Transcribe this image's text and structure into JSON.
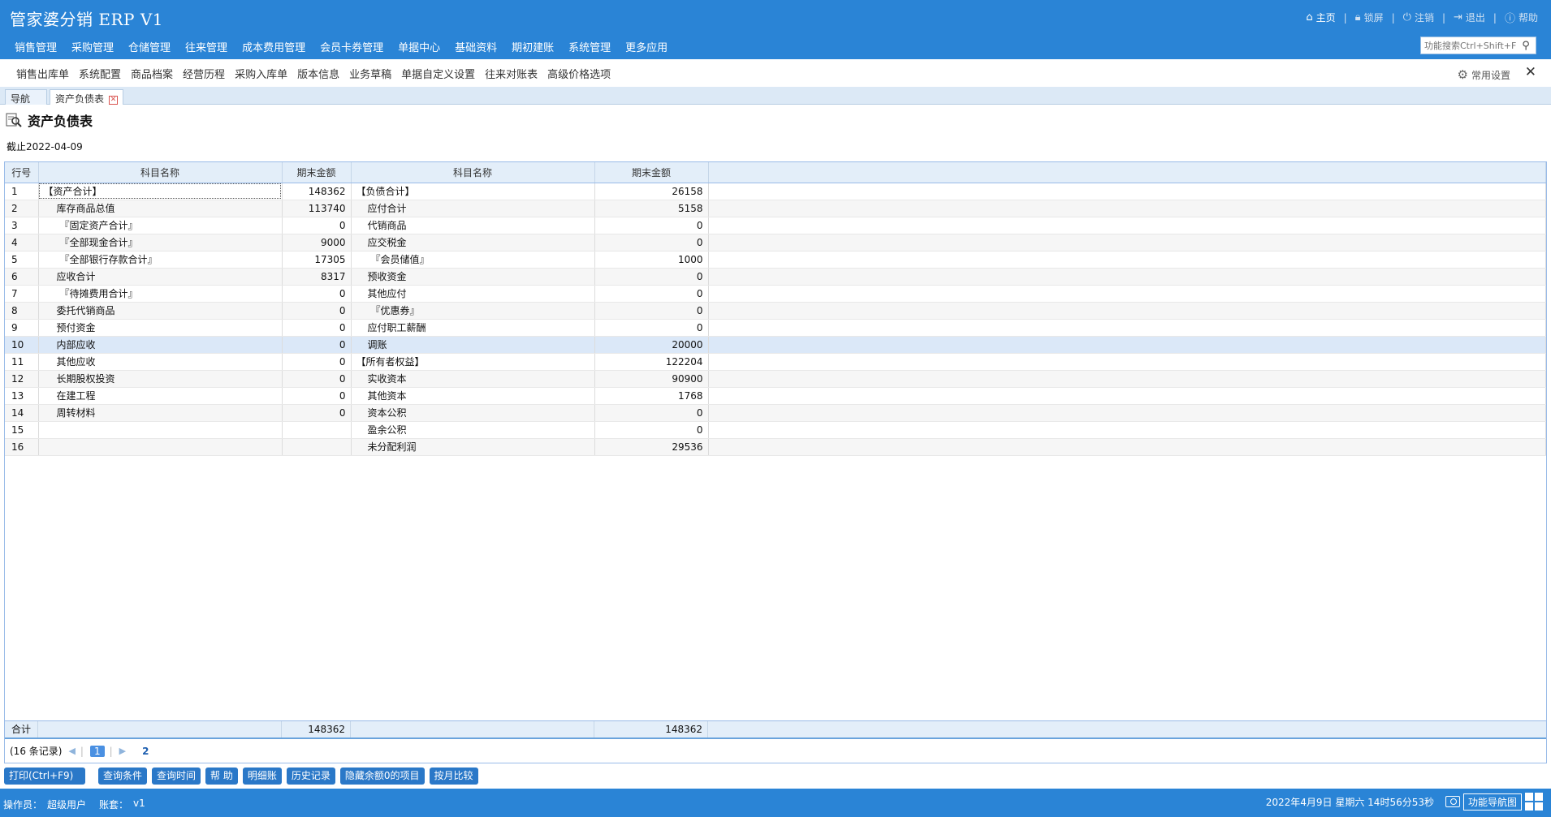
{
  "app": {
    "title": "管家婆分销 ERP V1"
  },
  "top_actions": [
    {
      "label": "主页",
      "icon": "home-icon"
    },
    {
      "label": "锁屏",
      "icon": "lock-icon"
    },
    {
      "label": "注销",
      "icon": "logout-icon"
    },
    {
      "label": "退出",
      "icon": "exit-icon"
    },
    {
      "label": "帮助",
      "icon": "info-icon"
    }
  ],
  "main_nav": [
    "销售管理",
    "采购管理",
    "仓储管理",
    "往来管理",
    "成本费用管理",
    "会员卡券管理",
    "单据中心",
    "基础资料",
    "期初建账",
    "系统管理",
    "更多应用"
  ],
  "search": {
    "placeholder": "功能搜索Ctrl+Shift+F"
  },
  "quick_links": [
    "销售出库单",
    "系统配置",
    "商品档案",
    "经营历程",
    "采购入库单",
    "版本信息",
    "业务草稿",
    "单据自定义设置",
    "往来对账表",
    "高级价格选项"
  ],
  "settings_label": "常用设置",
  "tabs": [
    {
      "label": "导航"
    },
    {
      "label": "资产负债表"
    }
  ],
  "page": {
    "title": "资产负债表",
    "as_of": "截止2022-04-09"
  },
  "table": {
    "headers": [
      "行号",
      "科目名称",
      "期末金额",
      "科目名称",
      "期末金额"
    ],
    "rows": [
      {
        "no": "1",
        "asset": "【资产合计】",
        "asset_amt": "148362",
        "liab": "【负债合计】",
        "liab_amt": "26158"
      },
      {
        "no": "2",
        "asset": "库存商品总值",
        "asset_amt": "113740",
        "liab": "应付合计",
        "liab_amt": "5158"
      },
      {
        "no": "3",
        "asset": "『固定资产合计』",
        "asset_amt": "0",
        "liab": "代销商品",
        "liab_amt": "0"
      },
      {
        "no": "4",
        "asset": "『全部现金合计』",
        "asset_amt": "9000",
        "liab": "应交税金",
        "liab_amt": "0"
      },
      {
        "no": "5",
        "asset": "『全部银行存款合计』",
        "asset_amt": "17305",
        "liab": "『会员储值』",
        "liab_amt": "1000"
      },
      {
        "no": "6",
        "asset": "应收合计",
        "asset_amt": "8317",
        "liab": "预收资金",
        "liab_amt": "0"
      },
      {
        "no": "7",
        "asset": "『待摊费用合计』",
        "asset_amt": "0",
        "liab": "其他应付",
        "liab_amt": "0"
      },
      {
        "no": "8",
        "asset": "委托代销商品",
        "asset_amt": "0",
        "liab": "『优惠券』",
        "liab_amt": "0"
      },
      {
        "no": "9",
        "asset": "预付资金",
        "asset_amt": "0",
        "liab": "应付职工薪酬",
        "liab_amt": "0"
      },
      {
        "no": "10",
        "asset": "内部应收",
        "asset_amt": "0",
        "liab": "调账",
        "liab_amt": "20000"
      },
      {
        "no": "11",
        "asset": "其他应收",
        "asset_amt": "0",
        "liab": "【所有者权益】",
        "liab_amt": "122204"
      },
      {
        "no": "12",
        "asset": "长期股权投资",
        "asset_amt": "0",
        "liab": "实收资本",
        "liab_amt": "90900"
      },
      {
        "no": "13",
        "asset": "在建工程",
        "asset_amt": "0",
        "liab": "其他资本",
        "liab_amt": "1768"
      },
      {
        "no": "14",
        "asset": "周转材料",
        "asset_amt": "0",
        "liab": "资本公积",
        "liab_amt": "0"
      },
      {
        "no": "15",
        "asset": "",
        "asset_amt": "",
        "liab": "盈余公积",
        "liab_amt": "0"
      },
      {
        "no": "16",
        "asset": "",
        "asset_amt": "",
        "liab": "未分配利润",
        "liab_amt": "29536"
      }
    ],
    "summary": {
      "label": "合计",
      "asset_total": "148362",
      "liab_total": "148362"
    }
  },
  "pager": {
    "records": "(16 条记录)",
    "current": "1",
    "next_page": "2"
  },
  "buttons": [
    "打印(Ctrl+F9)",
    "查询条件",
    "查询时间",
    "帮 助",
    "明细账",
    "历史记录",
    "隐藏余额0的项目",
    "按月比较"
  ],
  "status": {
    "operator_label": "操作员：",
    "operator": "超级用户",
    "account_label": "账套：",
    "account": "v1",
    "datetime": "2022年4月9日  星期六  14时56分53秒",
    "nav_map": "功能导航图"
  }
}
